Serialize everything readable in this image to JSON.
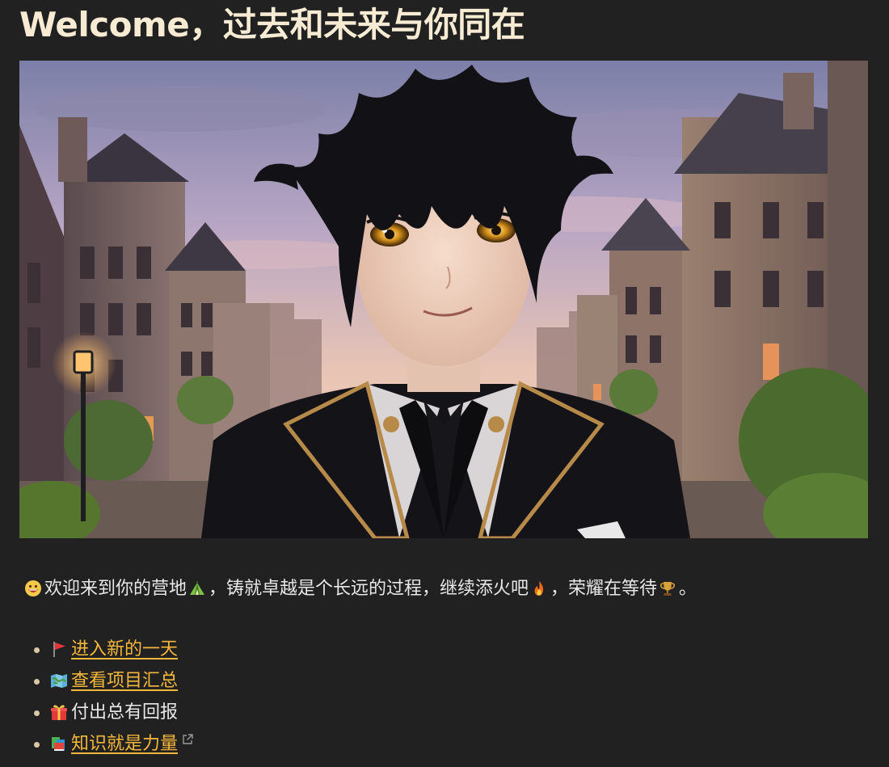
{
  "page": {
    "title": "Welcome，过去和未来与你同在"
  },
  "hero": {
    "image_name": "anime-boy-in-black-suit-on-old-town-street-at-sunset"
  },
  "intro": {
    "segments": [
      {
        "type": "icon",
        "name": "grinning-face-emoji"
      },
      {
        "type": "text",
        "value": "欢迎来到你的营地"
      },
      {
        "type": "icon",
        "name": "tent-emoji"
      },
      {
        "type": "text",
        "value": "，铸就卓越是个长远的过程，继续添火吧"
      },
      {
        "type": "icon",
        "name": "fire-emoji"
      },
      {
        "type": "text",
        "value": "，荣耀在等待"
      },
      {
        "type": "icon",
        "name": "trophy-emoji"
      },
      {
        "type": "text",
        "value": "。"
      }
    ],
    "t1": "欢迎来到你的营地",
    "t2": "，铸就卓越是个长远的过程，继续添火吧",
    "t3": "，荣耀在等待",
    "t4": "。"
  },
  "links": [
    {
      "icon": "red-flag-icon",
      "label": "进入新的一天",
      "is_link": true,
      "external": false
    },
    {
      "icon": "map-icon",
      "label": "查看项目汇总",
      "is_link": true,
      "external": false
    },
    {
      "icon": "gift-icon",
      "label": "付出总有回报",
      "is_link": false,
      "external": false
    },
    {
      "icon": "books-icon",
      "label": "知识就是力量",
      "is_link": true,
      "external": true
    }
  ],
  "colors": {
    "background": "#212121",
    "title": "#f7ecd3",
    "text": "#e8e8e8",
    "link": "#f5b73a"
  }
}
